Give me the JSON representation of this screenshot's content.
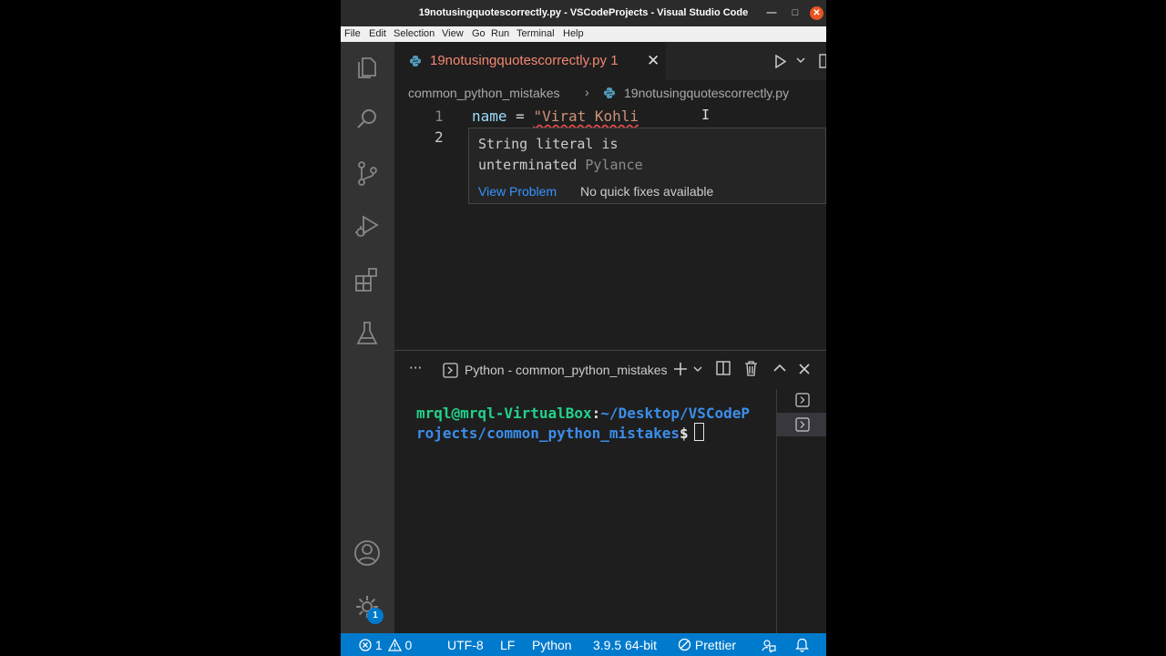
{
  "window": {
    "title": "19notusingquotescorrectly.py - VSCodeProjects - Visual Studio Code"
  },
  "menu": [
    "File",
    "Edit",
    "Selection",
    "View",
    "Go",
    "Run",
    "Terminal",
    "Help"
  ],
  "tab": {
    "label": "19notusingquotescorrectly.py",
    "problem_count": "1"
  },
  "breadcrumb": {
    "folder": "common_python_mistakes",
    "file": "19notusingquotescorrectly.py"
  },
  "code": {
    "line_numbers": [
      "1",
      "2"
    ],
    "line1_var": "name",
    "line1_op": " = ",
    "line1_string": "\"Virat Kohli"
  },
  "hover": {
    "message": "String literal is unterminated",
    "source": "Pylance",
    "view_problem": "View Problem",
    "no_fixes": "No quick fixes available"
  },
  "panel": {
    "more": "···",
    "terminal_title": "Python - common_python_mistakes"
  },
  "terminal": {
    "user": "mrql@mrql-VirtualBox",
    "sep": ":",
    "path": "~/Desktop/VSCodeProjects/common_python_mistakes",
    "dollar": "$"
  },
  "activity": {
    "settings_badge": "1"
  },
  "status": {
    "errors": "1",
    "warnings": "0",
    "encoding": "UTF-8",
    "eol": "LF",
    "language": "Python",
    "interpreter": "3.9.5 64-bit",
    "formatter": "Prettier"
  },
  "colors": {
    "accent": "#007acc",
    "error": "#f48771",
    "close": "#e95420"
  }
}
